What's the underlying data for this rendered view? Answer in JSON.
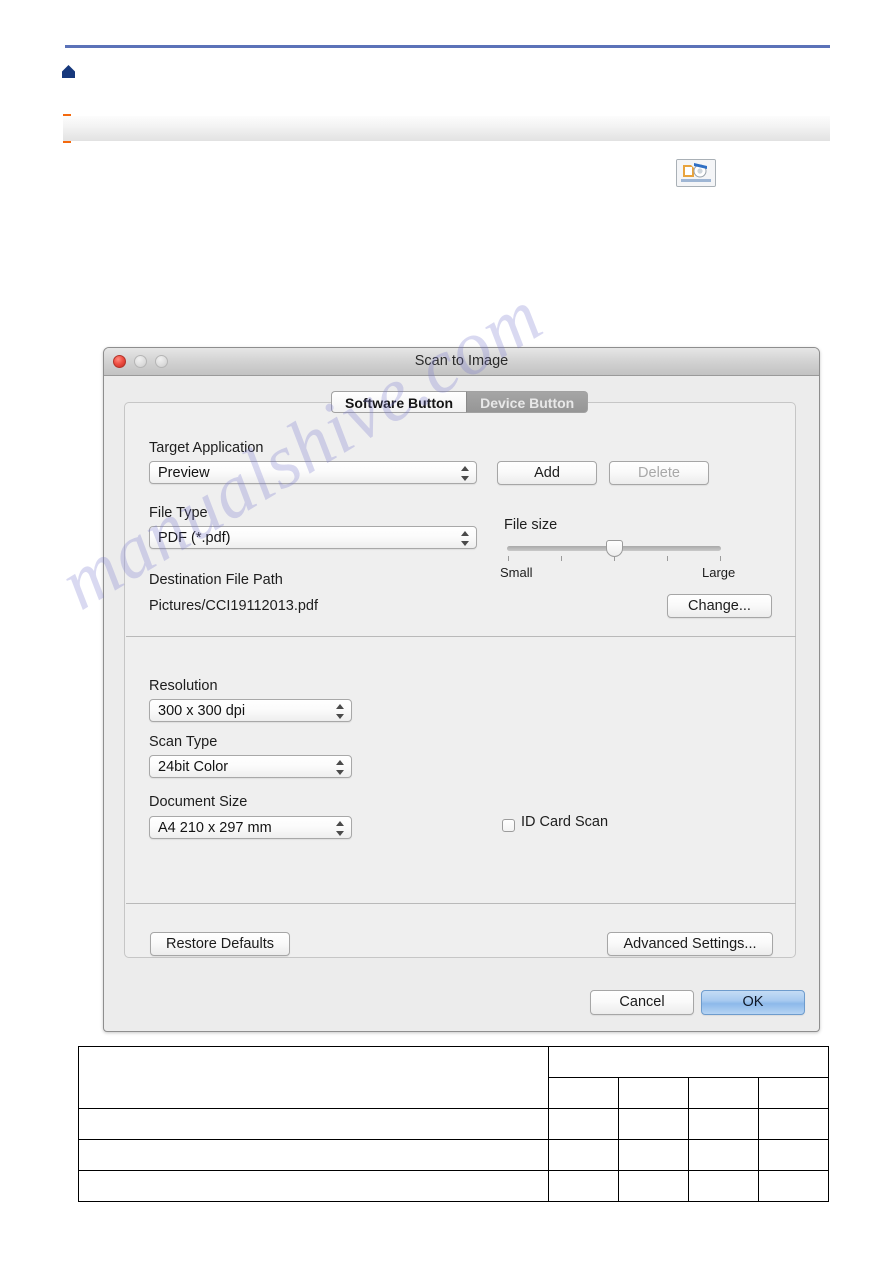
{
  "page": {
    "watermark": "manualshive.com",
    "home_icon": "home-icon",
    "app_icon": "scan-app-icon"
  },
  "dialog": {
    "title": "Scan to Image",
    "window_controls": [
      {
        "name": "close",
        "state": "active"
      },
      {
        "name": "minimize",
        "state": "disabled"
      },
      {
        "name": "zoom",
        "state": "disabled"
      }
    ],
    "tabs": [
      {
        "label": "Software Button",
        "active": true
      },
      {
        "label": "Device Button",
        "active": false
      }
    ],
    "target_application": {
      "label": "Target Application",
      "value": "Preview",
      "add_label": "Add",
      "delete_label": "Delete",
      "delete_disabled": true
    },
    "file_type": {
      "label": "File Type",
      "value": "PDF (*.pdf)"
    },
    "file_size": {
      "label": "File size",
      "min_label": "Small",
      "max_label": "Large",
      "position_percent": 50,
      "tick_count": 5
    },
    "destination": {
      "label": "Destination File Path",
      "value": "Pictures/CCI19112013.pdf",
      "change_label": "Change..."
    },
    "resolution": {
      "label": "Resolution",
      "value": "300 x 300 dpi"
    },
    "scan_type": {
      "label": "Scan Type",
      "value": "24bit Color"
    },
    "document_size": {
      "label": "Document Size",
      "value": "A4 210 x 297 mm"
    },
    "id_card_scan": {
      "label": "ID Card Scan",
      "checked": false
    },
    "footer": {
      "restore_defaults_label": "Restore Defaults",
      "advanced_settings_label": "Advanced Settings...",
      "cancel_label": "Cancel",
      "ok_label": "OK"
    }
  },
  "table": {
    "rows": [
      [
        "",
        "",
        "",
        "",
        ""
      ],
      [
        "",
        "",
        "",
        "",
        ""
      ],
      [
        "",
        "",
        "",
        "",
        ""
      ],
      [
        "",
        "",
        "",
        "",
        ""
      ],
      [
        "",
        "",
        "",
        "",
        ""
      ]
    ]
  }
}
